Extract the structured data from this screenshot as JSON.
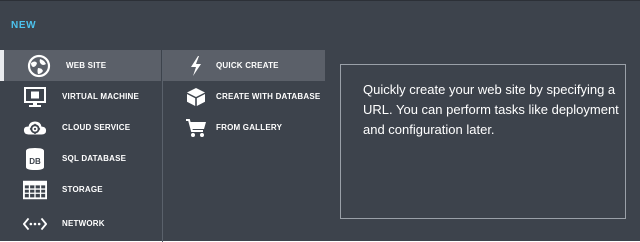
{
  "header": {
    "title": "NEW"
  },
  "categories": [
    {
      "label": "WEB SITE",
      "icon": "globe-icon",
      "selected": true
    },
    {
      "label": "VIRTUAL MACHINE",
      "icon": "monitor-icon",
      "selected": false
    },
    {
      "label": "CLOUD SERVICE",
      "icon": "cloud-gear-icon",
      "selected": false
    },
    {
      "label": "SQL DATABASE",
      "icon": "database-icon",
      "selected": false
    },
    {
      "label": "STORAGE",
      "icon": "table-grid-icon",
      "selected": false
    },
    {
      "label": "NETWORK",
      "icon": "network-icon",
      "selected": false
    }
  ],
  "options": [
    {
      "label": "QUICK CREATE",
      "icon": "lightning-icon",
      "selected": true
    },
    {
      "label": "CREATE WITH DATABASE",
      "icon": "cube-icon",
      "selected": false
    },
    {
      "label": "FROM GALLERY",
      "icon": "cart-icon",
      "selected": false
    }
  ],
  "description": {
    "text": "Quickly create your web site by specifying a URL. You can perform tasks like deployment and configuration later."
  },
  "colors": {
    "panel_bg": "#3d434c",
    "selected_bg": "#5b6069",
    "header_accent": "#4cc3ee"
  }
}
